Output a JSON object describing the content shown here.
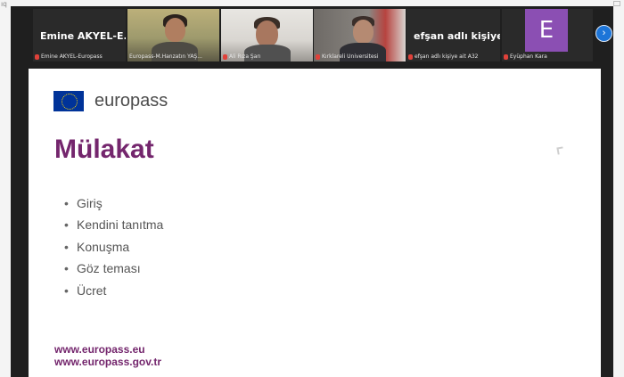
{
  "window": {
    "tag": "ıq"
  },
  "meeting": {
    "participants": [
      {
        "type": "name",
        "display_name": "Emine AKYEL-E...",
        "label": "Emine AKYEL-Europass"
      },
      {
        "type": "video",
        "label": "Europass-M.Hanzatın YAŞ..."
      },
      {
        "type": "video",
        "label": "Ali Rıza Şarı"
      },
      {
        "type": "video",
        "label": "Kırklareli Üniversitesi"
      },
      {
        "type": "name",
        "display_name": "efşan adlı kişiye...",
        "label": "efşan adlı kişiye ait A32"
      },
      {
        "type": "avatar",
        "letter": "E",
        "label": "Eyüphan Kara"
      }
    ],
    "next_icon": "chevron-right-icon"
  },
  "slide": {
    "brand": "europass",
    "title": "Mülakat",
    "bullets": [
      "Giriş",
      "Kendini tanıtma",
      "Konuşma",
      "Göz teması",
      "Ücret"
    ],
    "footer": [
      "www.europass.eu",
      "www.europass.gov.tr"
    ]
  },
  "colors": {
    "accent": "#74266d",
    "avatar": "#8b4fb3",
    "eu_blue": "#003399",
    "nav": "#1d75d8"
  }
}
